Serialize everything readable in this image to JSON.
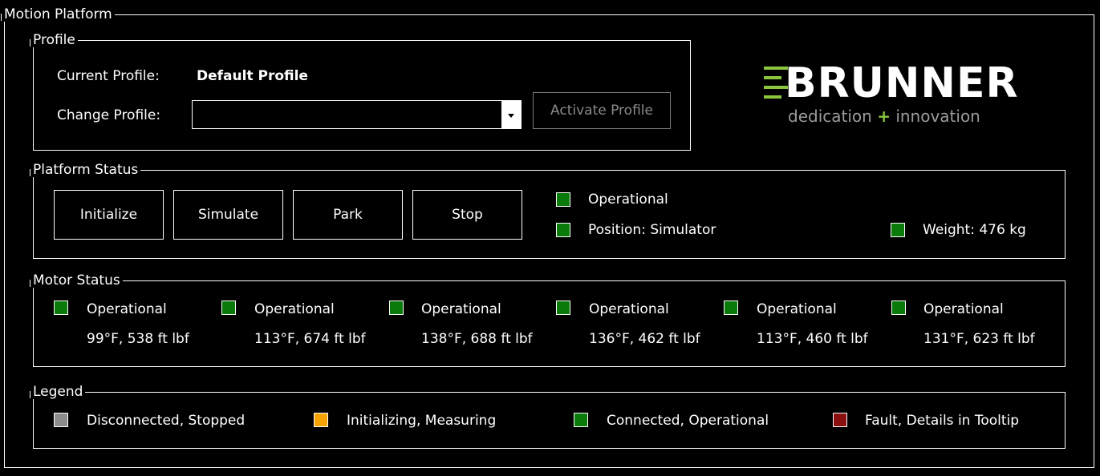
{
  "title": "Motion Platform",
  "colors": {
    "green": "#0a7a0a",
    "gray": "#8c8c8c",
    "orange": "#f5a300",
    "red": "#8b0f0f",
    "brand_green": "#8cc63f",
    "brand_gray": "#9a9a9a"
  },
  "profile": {
    "legend": "Profile",
    "current_label": "Current Profile:",
    "current_value": "Default Profile",
    "change_label": "Change Profile:",
    "select_value": "",
    "activate_button": "Activate Profile"
  },
  "logo": {
    "name": "BRUNNER",
    "tagline_left": "dedication",
    "tagline_plus": "+",
    "tagline_right": "innovation"
  },
  "platform_status": {
    "legend": "Platform Status",
    "buttons": [
      "Initialize",
      "Simulate",
      "Park",
      "Stop"
    ],
    "indicators": [
      {
        "label": "Operational",
        "color": "green"
      },
      {
        "label": "Position: Simulator",
        "color": "green"
      },
      {
        "label": "Weight: 476 kg",
        "color": "green"
      }
    ]
  },
  "motor_status": {
    "legend": "Motor Status",
    "motors": [
      {
        "status": "Operational",
        "reading": "99°F, 538 ft lbf",
        "color": "green"
      },
      {
        "status": "Operational",
        "reading": "113°F, 674 ft lbf",
        "color": "green"
      },
      {
        "status": "Operational",
        "reading": "138°F, 688 ft lbf",
        "color": "green"
      },
      {
        "status": "Operational",
        "reading": "136°F, 462 ft lbf",
        "color": "green"
      },
      {
        "status": "Operational",
        "reading": "113°F, 460 ft lbf",
        "color": "green"
      },
      {
        "status": "Operational",
        "reading": "131°F, 623 ft lbf",
        "color": "green"
      }
    ]
  },
  "legend_box": {
    "legend": "Legend",
    "items": [
      {
        "label": "Disconnected, Stopped",
        "color": "gray"
      },
      {
        "label": "Initializing, Measuring",
        "color": "orange"
      },
      {
        "label": "Connected, Operational",
        "color": "green"
      },
      {
        "label": "Fault, Details in Tooltip",
        "color": "red"
      }
    ]
  }
}
